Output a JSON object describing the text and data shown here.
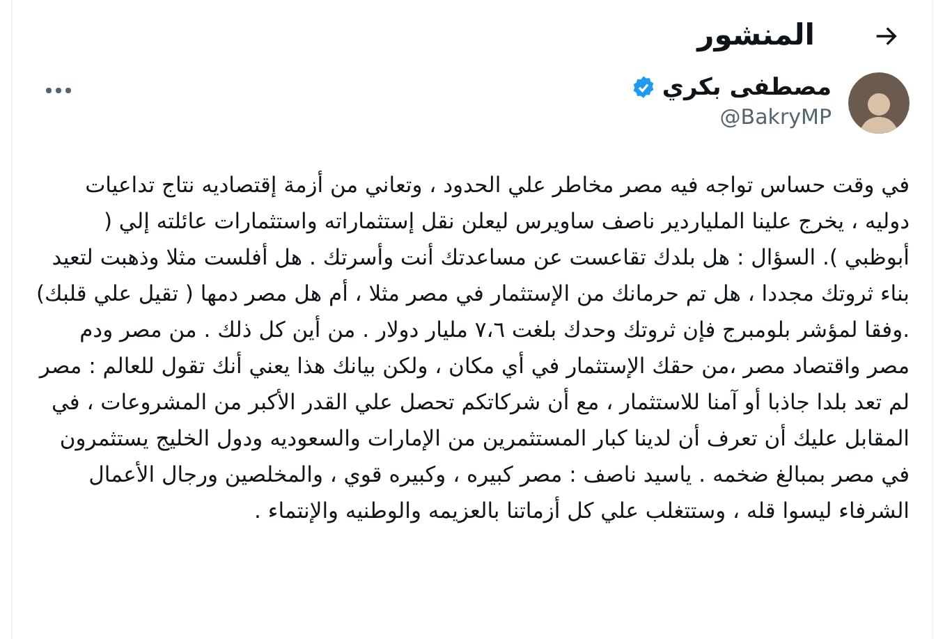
{
  "header": {
    "title": "المنشور"
  },
  "author": {
    "name": "مصطفى بكري",
    "handle": "@BakryMP",
    "verified": true
  },
  "post": {
    "text": "في وقت حساس تواجه فيه مصر مخاطر علي الحدود ، وتعاني من أزمة إقتصاديه نتاج تداعيات دوليه ، يخرج علينا الملياردير ناصف ساويرس ليعلن نقل إستثماراته واستثمارات عائلته إلي ( أبوظبي ). السؤال : هل بلدك تقاعست عن مساعدتك أنت وأسرتك . هل أفلست مثلا وذهبت لتعيد بناء ثروتك مجددا ، هل تم  حرمانك من الإستثمار في مصر مثلا ، أم هل مصر دمها ( تقيل علي قلبك)  .وفقا لمؤشر بلومبرج فإن ثروتك وحدك بلغت ٧،٦ مليار دولار . من أين كل ذلك . من مصر ودم مصر واقتصاد مصر ،من حقك الإستثمار في أي مكان ، ولكن بيانك هذا يعني أنك تقول للعالم : مصر لم تعد بلدا جاذبا أو آمنا للاستثمار ، مع أن شركاتكم تحصل علي القدر الأكبر من المشروعات ، في المقابل عليك أن تعرف أن لدينا كبار المستثمرين من الإمارات والسعوديه ودول الخليج يستثمرون في مصر بمبالغ ضخمه . ياسيد ناصف : مصر كبيره ، وكبيره قوي ، والمخلصين ورجال الأعمال الشرفاء ليسوا قله ، وستتغلب علي كل أزماتنا بالعزيمه والوطنيه والإنتماء ."
  }
}
